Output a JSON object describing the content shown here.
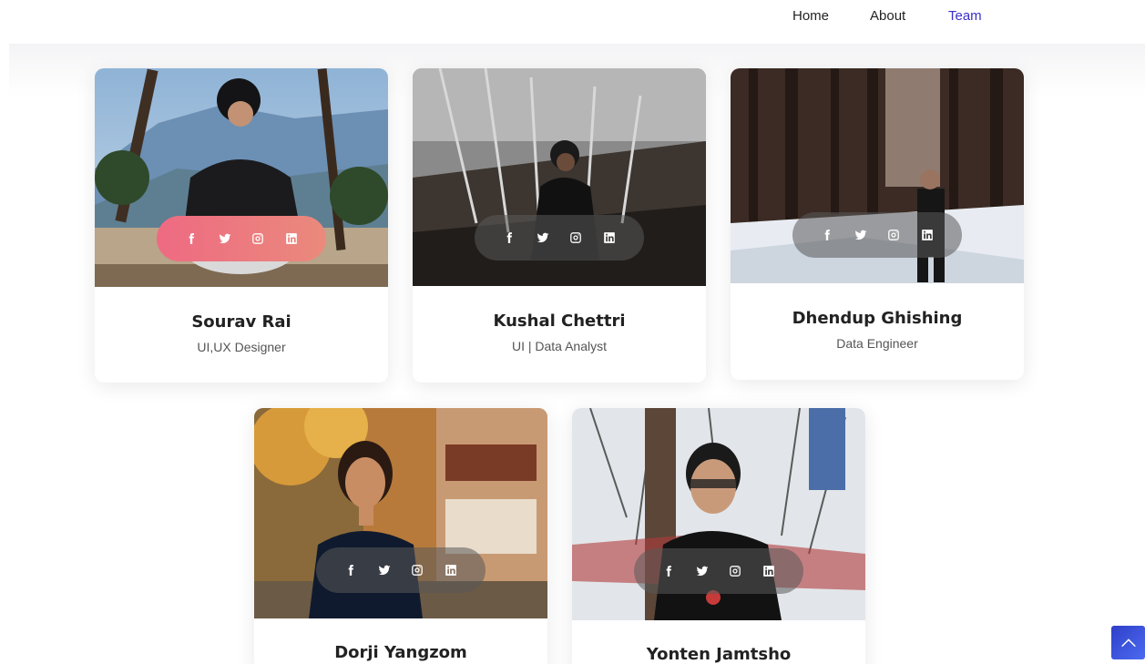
{
  "nav": {
    "items": [
      {
        "label": "Home"
      },
      {
        "label": "About"
      },
      {
        "label": "Team"
      }
    ]
  },
  "team": [
    {
      "name": "Sourav Rai",
      "role": "UI,UX Designer"
    },
    {
      "name": "Kushal Chettri",
      "role": "UI | Data Analyst"
    },
    {
      "name": "Dhendup Ghishing",
      "role": "Data Engineer"
    },
    {
      "name": "Dorji Yangzom",
      "role": ""
    },
    {
      "name": "Yonten Jamtsho",
      "role": ""
    }
  ],
  "social_icons": [
    "facebook-icon",
    "twitter-icon",
    "instagram-icon",
    "linkedin-icon"
  ],
  "colors": {
    "nav_active": "#3b2fc9",
    "social_highlight": "#ee6a82",
    "scroll_top": "#3a4fd8"
  }
}
